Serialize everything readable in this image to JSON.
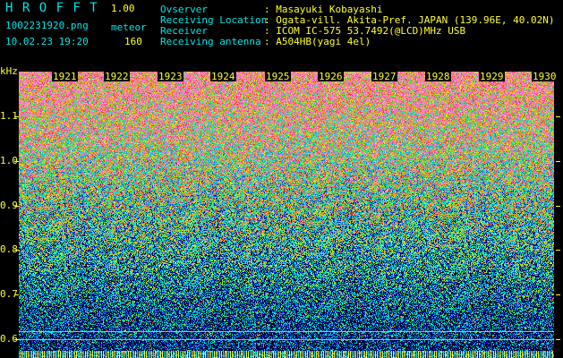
{
  "app": {
    "title": "H R O F F T",
    "version": "1.00",
    "filename": "1002231920.png",
    "mode": "meteor",
    "datetime": "10.02.23 19:20",
    "count": "160"
  },
  "info": {
    "observer_label": "Ovserver",
    "observer_value": ": Masayuki Kobayashi",
    "location_label": "Receiving Location",
    "location_value": ": Ogata-vill. Akita-Pref. JAPAN (139.96E, 40.02N)",
    "receiver_label": "Receiver",
    "receiver_value": ": ICOM IC-575 53.7492(@LCD)MHz USB",
    "antenna_label": "Receiving antenna",
    "antenna_value": ": A504HB(yagi 4el)"
  },
  "axis": {
    "y_unit": "kHz",
    "y_ticks": [
      "1.1",
      "1.0",
      "0.9",
      "0.8",
      "0.7",
      "0.6"
    ],
    "x_ticks": [
      "1921",
      "1922",
      "1923",
      "1924",
      "1925",
      "1926",
      "1927",
      "1928",
      "1929",
      "1930"
    ]
  },
  "colors": {
    "header_text": "#00e6e6",
    "value_text": "#ffff33",
    "axis": "#ffff33"
  }
}
